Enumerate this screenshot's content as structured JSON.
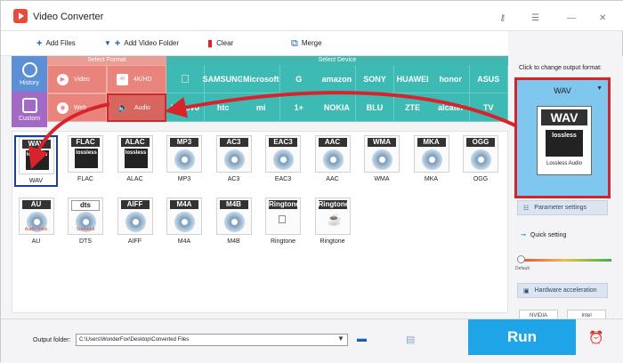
{
  "app": {
    "title": "Video Converter"
  },
  "toolbar": {
    "add_files": "Add Files",
    "add_video_folder": "Add Video Folder",
    "clear": "Clear",
    "merge": "Merge"
  },
  "sidebar": {
    "history": "History",
    "custom": "Custom"
  },
  "categories": {
    "select_format": "Select Format",
    "select_device": "Select Device",
    "formats": [
      "Video",
      "4K/HD",
      "Web",
      "Audio"
    ],
    "devices_row1": [
      "",
      "SAMSUNG",
      "Microsoft",
      "G",
      "amazon",
      "SONY",
      "HUAWEI",
      "honor",
      "ASUS"
    ],
    "devices_row2": [
      "Lenovo",
      "htc",
      "mi",
      "1+",
      "NOKIA",
      "BLU",
      "ZTE",
      "alcatel",
      "TV"
    ]
  },
  "audio_formats": [
    {
      "badge": "WAV",
      "label": "WAV",
      "logo": "lossless",
      "sub": "Lossless Audio"
    },
    {
      "badge": "FLAC",
      "label": "FLAC",
      "logo": "lossless",
      "sub": "Lossless Audio"
    },
    {
      "badge": "ALAC",
      "label": "ALAC",
      "logo": "lossless",
      "sub": "Lossless Audio"
    },
    {
      "badge": "MP3",
      "label": "MP3"
    },
    {
      "badge": "AC3",
      "label": "AC3"
    },
    {
      "badge": "EAC3",
      "label": "EAC3"
    },
    {
      "badge": "AAC",
      "label": "AAC"
    },
    {
      "badge": "WMA",
      "label": "WMA"
    },
    {
      "badge": "MKA",
      "label": "MKA"
    },
    {
      "badge": "OGG",
      "label": "OGG"
    },
    {
      "badge": "AU",
      "label": "AU",
      "sub": "Audio Units"
    },
    {
      "badge": "dts",
      "label": "DTS",
      "sub": "Surround"
    },
    {
      "badge": "AIFF",
      "label": "AIFF"
    },
    {
      "badge": "M4A",
      "label": "M4A"
    },
    {
      "badge": "M4B",
      "label": "M4B"
    },
    {
      "badge": "Ringtone",
      "label": "Ringtone"
    },
    {
      "badge": "Ringtone",
      "label": "Ringtone"
    }
  ],
  "right_panel": {
    "hint": "Click to change output format:",
    "selected_format": "WAV",
    "card_badge": "WAV",
    "card_logo": "lossless",
    "card_sub": "Lossless Audio",
    "parameter_settings": "Parameter settings",
    "quick_setting": "Quick setting",
    "default_label": "Default",
    "hardware_acceleration": "Hardware acceleration",
    "nvidia": "NVIDIA",
    "intel": "Intel"
  },
  "bottom": {
    "output_folder_label": "Output folder:",
    "output_folder_value": "C:\\Users\\WonderFox\\Desktop\\Converted Files",
    "run": "Run"
  },
  "colors": {
    "format_coral": "#e9847c",
    "device_teal": "#3dbab3",
    "highlight_red": "#d7242b",
    "run_blue": "#1ea4e7",
    "selected_border": "#173da5"
  }
}
